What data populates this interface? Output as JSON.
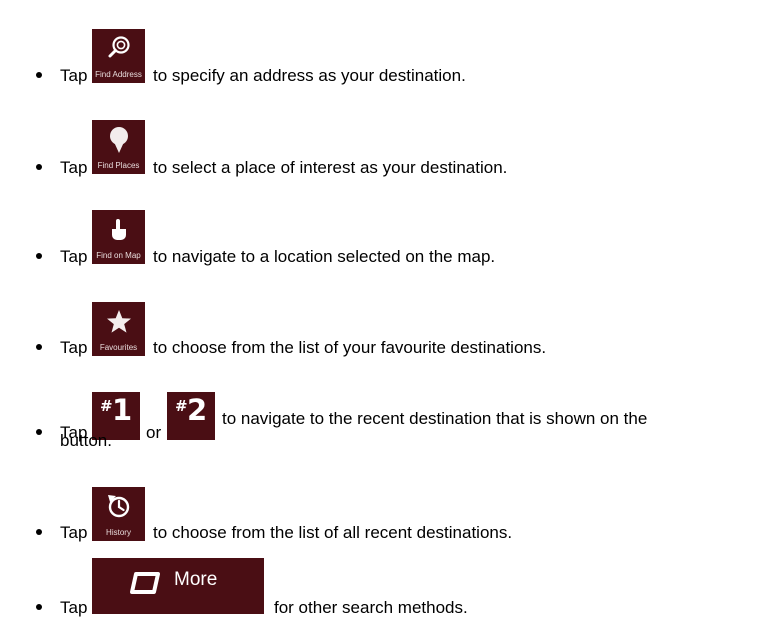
{
  "colors": {
    "button_bg": "#4a0e14",
    "button_text": "#ffffff",
    "body_text": "#000000"
  },
  "items": [
    {
      "lead": "Tap",
      "button_label": "Find Address",
      "button_icon": "search-address-icon",
      "description": "to specify an address as your destination."
    },
    {
      "lead": "Tap",
      "button_label": "Find Places",
      "button_icon": "map-pin-icon",
      "description": "to select a place of interest as your destination."
    },
    {
      "lead": "Tap",
      "button_label": "Find on Map",
      "button_icon": "hand-pointer-icon",
      "description": "to navigate to a location selected on the map."
    },
    {
      "lead": "Tap",
      "button_label": "Favourites",
      "button_icon": "star-icon",
      "description": "to choose from the list of your favourite destinations."
    },
    {
      "lead": "Tap",
      "recent1": {
        "hash": "#",
        "number": "1"
      },
      "connector": "or",
      "recent2": {
        "hash": "#",
        "number": "2"
      },
      "description_line1": "to navigate to the recent destination that is shown on the",
      "description_line2": "button."
    },
    {
      "lead": "Tap",
      "button_label": "History",
      "button_icon": "history-icon",
      "description": "to choose from the list of all recent destinations."
    },
    {
      "lead": "Tap",
      "button_label": "More",
      "button_icon": "more-icon",
      "description": "for other search methods."
    }
  ]
}
